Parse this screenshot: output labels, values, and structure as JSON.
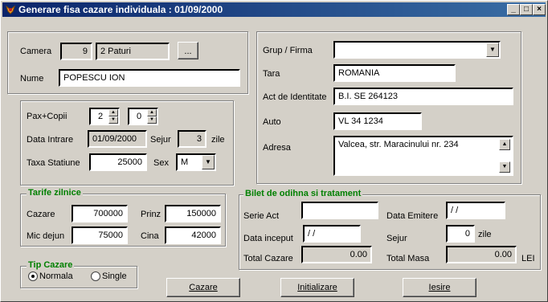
{
  "window": {
    "title": "Generare fisa cazare individuala : 01/09/2000",
    "icons": [
      "app-icon",
      "minimize-icon",
      "maximize-icon",
      "close-icon"
    ]
  },
  "room": {
    "camera_label": "Camera",
    "camera_value": "9",
    "type_value": "2 Paturi",
    "browse_label": "...",
    "nume_label": "Nume",
    "nume_value": "POPESCU ION"
  },
  "stay": {
    "pax_label": "Pax+Copii",
    "pax_value": "2",
    "copii_value": "0",
    "data_intrare_label": "Data Intrare",
    "data_intrare_value": "01/09/2000",
    "sejur_label": "Sejur",
    "sejur_value": "3",
    "zile_label": "zile",
    "taxa_label": "Taxa Statiune",
    "taxa_value": "25000",
    "sex_label": "Sex",
    "sex_value": "M"
  },
  "tarife": {
    "title": "Tarife zilnice",
    "cazare_label": "Cazare",
    "cazare_value": "700000",
    "prinz_label": "Prinz",
    "prinz_value": "150000",
    "mic_dejun_label": "Mic dejun",
    "mic_dejun_value": "75000",
    "cina_label": "Cina",
    "cina_value": "42000"
  },
  "tip_cazare": {
    "title": "Tip Cazare",
    "normala_label": "Normala",
    "single_label": "Single",
    "selected": "Normala"
  },
  "guest": {
    "grup_label": "Grup / Firma",
    "grup_value": "",
    "tara_label": "Tara",
    "tara_value": "ROMANIA",
    "act_label": "Act de Identitate",
    "act_value": "B.I. SE 264123",
    "auto_label": "Auto",
    "auto_value": "VL 34 1234",
    "adresa_label": "Adresa",
    "adresa_value": "Valcea, str. Maracinului nr. 234"
  },
  "bilet": {
    "title": "Bilet de odihna si tratament",
    "serie_label": "Serie Act",
    "serie_value": "",
    "data_emitere_label": "Data Emitere",
    "data_emitere_value": "/ /",
    "data_inceput_label": "Data inceput",
    "data_inceput_value": "/ /",
    "sejur_label": "Sejur",
    "sejur_value": "0",
    "zile_label": "zile",
    "total_cazare_label": "Total Cazare",
    "total_cazare_value": "0.00",
    "total_masa_label": "Total Masa",
    "total_masa_value": "0.00",
    "lei_label": "LEI"
  },
  "buttons": {
    "cazare": "Cazare",
    "initializare": "Initializare",
    "iesire": "Iesire"
  },
  "colors": {
    "title_start": "#0a246a",
    "title_end": "#3a6ea5",
    "group_title": "#008000",
    "face": "#d4d0c8"
  }
}
